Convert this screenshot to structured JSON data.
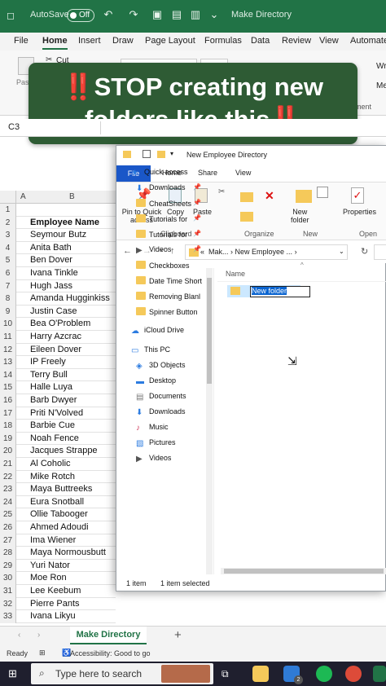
{
  "excel": {
    "autosave_label": "AutoSave",
    "autosave_state": "Off",
    "doc_title": "Make Directory",
    "tabs": [
      "File",
      "Home",
      "Insert",
      "Draw",
      "Page Layout",
      "Formulas",
      "Data",
      "Review",
      "View",
      "Automate"
    ],
    "ribbon_cut": "Cut",
    "ribbon_paste": "Past",
    "ribbon_right1": "Wr",
    "ribbon_right2": "Me",
    "ribbon_right3": "ment",
    "name_box": "C3",
    "col_a": "A",
    "col_b": "B",
    "row_numbers": [
      "1",
      "2",
      "3",
      "4",
      "5",
      "6",
      "7",
      "8",
      "9",
      "10",
      "11",
      "12",
      "13",
      "14",
      "15",
      "16",
      "17",
      "18",
      "19",
      "20",
      "21",
      "22",
      "23",
      "24",
      "25",
      "26",
      "27",
      "28",
      "29",
      "30",
      "31",
      "32",
      "33"
    ],
    "cells": [
      "",
      "Employee Name",
      "Seymour Butz",
      "Anita Bath",
      "Ben Dover",
      "Ivana Tinkle",
      "Hugh Jass",
      "Amanda Hugginkiss",
      "Justin Case",
      "Bea O'Problem",
      "Harry Azcrac",
      "Eileen Dover",
      "IP Freely",
      "Terry Bull",
      "Halle Luya",
      "Barb Dwyer",
      "Priti N'Volved",
      "Barbie Cue",
      "Noah Fence",
      "Jacques Strappe",
      "Al Coholic",
      "Mike Rotch",
      "Maya Buttreeks",
      "Eura Snotball",
      "Ollie Tabooger",
      "Ahmed Adoudi",
      "Ima Wiener",
      "Maya Normousbutt",
      "Yuri Nator",
      "Moe Ron",
      "Lee Keebum",
      "Pierre Pants",
      "Ivana Likyu"
    ],
    "sheet_tab": "Make Directory",
    "add_sheet": "+",
    "status_ready": "Ready",
    "status_accessibility": "Accessibility: Good to go",
    "accent": "#217346"
  },
  "overlay": {
    "line1_prefix": "‼️",
    "line1": "STOP creating new",
    "line2": "folders like this",
    "line2_suffix": "‼️"
  },
  "explorer": {
    "title": "New Employee Directory",
    "tabs": [
      "File",
      "Home",
      "Share",
      "View"
    ],
    "ribbon": {
      "pin": "Pin to Quick\naccess",
      "copy": "Copy",
      "paste": "Paste",
      "new_folder": "New\nfolder",
      "properties": "Properties",
      "groups": [
        "Clipboard",
        "Organize",
        "New",
        "Open"
      ]
    },
    "address": [
      "Mak...",
      "New Employee ..."
    ],
    "column_name": "Name",
    "nav": [
      {
        "label": "Quick access",
        "icon": "star-icon",
        "pinned": false
      },
      {
        "label": "Downloads",
        "icon": "download-icon",
        "pinned": true
      },
      {
        "label": "CheatSheets",
        "icon": "folder-icon",
        "pinned": true
      },
      {
        "label": "Tutorials for",
        "icon": "folder-icon",
        "pinned": true
      },
      {
        "label": "Tutorials for",
        "icon": "folder-icon",
        "pinned": true
      },
      {
        "label": "Videos",
        "icon": "video-icon",
        "pinned": true
      },
      {
        "label": "Checkboxes",
        "icon": "folder-icon",
        "pinned": false
      },
      {
        "label": "Date Time Short",
        "icon": "folder-icon",
        "pinned": false
      },
      {
        "label": "Removing Blanl",
        "icon": "folder-icon",
        "pinned": false
      },
      {
        "label": "Spinner Button",
        "icon": "folder-icon",
        "pinned": false
      },
      {
        "label": "iCloud Drive",
        "icon": "cloud-icon",
        "pinned": false
      },
      {
        "label": "This PC",
        "icon": "computer-icon",
        "pinned": false
      },
      {
        "label": "3D Objects",
        "icon": "cube-icon",
        "pinned": false
      },
      {
        "label": "Desktop",
        "icon": "desktop-icon",
        "pinned": false
      },
      {
        "label": "Documents",
        "icon": "document-icon",
        "pinned": false
      },
      {
        "label": "Downloads",
        "icon": "download-icon",
        "pinned": false
      },
      {
        "label": "Music",
        "icon": "music-icon",
        "pinned": false
      },
      {
        "label": "Pictures",
        "icon": "picture-icon",
        "pinned": false
      },
      {
        "label": "Videos",
        "icon": "video-icon",
        "pinned": false
      }
    ],
    "new_folder_value": "New folder",
    "status_count": "1 item",
    "status_selected": "1 item selected"
  },
  "taskbar": {
    "search_placeholder": "Type here to search",
    "mail_badge": "2"
  }
}
